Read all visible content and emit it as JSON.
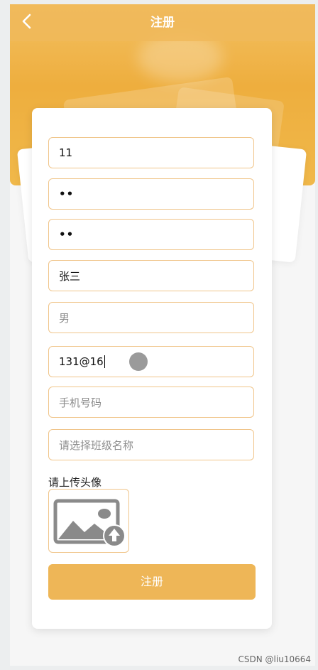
{
  "header": {
    "title": "注册",
    "back_icon": "chevron-left-icon"
  },
  "form": {
    "fields": [
      {
        "name": "account",
        "value": "11",
        "placeholder": ""
      },
      {
        "name": "password",
        "value": "••",
        "placeholder": ""
      },
      {
        "name": "confirm-password",
        "value": "••",
        "placeholder": ""
      },
      {
        "name": "name",
        "value": "张三",
        "placeholder": ""
      },
      {
        "name": "gender",
        "value": "",
        "placeholder": "男"
      },
      {
        "name": "email",
        "value": "131@16",
        "placeholder": ""
      },
      {
        "name": "phone",
        "value": "",
        "placeholder": "手机号码"
      },
      {
        "name": "class",
        "value": "",
        "placeholder": "请选择班级名称"
      }
    ],
    "avatar_label": "请上传头像",
    "avatar_icon": "image-upload-icon",
    "submit_label": "注册"
  },
  "colors": {
    "accent": "#eeb657",
    "field_border": "#f0c58a",
    "header_bg": "#f0b85a"
  },
  "watermark": "CSDN @liu10664"
}
